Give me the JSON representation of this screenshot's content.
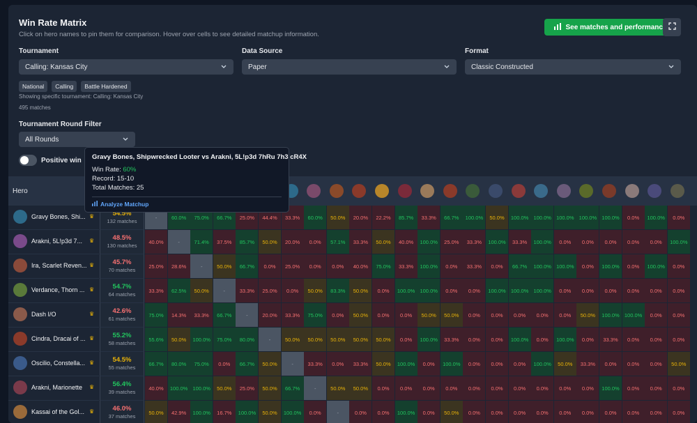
{
  "header": {
    "title": "Win Rate Matrix",
    "subtitle": "Click on hero names to pin them for comparison. Hover over cells to see detailed matchup information.",
    "matches_button": "See matches and performance"
  },
  "filters": {
    "tournament": {
      "label": "Tournament",
      "value": "Calling: Kansas City"
    },
    "data_source": {
      "label": "Data Source",
      "value": "Paper"
    },
    "format": {
      "label": "Format",
      "value": "Classic Constructed"
    },
    "tags": [
      "National",
      "Calling",
      "Battle Hardened"
    ],
    "showing_note": "Showing specific tournament: Calling: Kansas City",
    "match_count": "495 matches",
    "round": {
      "label": "Tournament Round Filter",
      "value": "All Rounds"
    },
    "toggle_label": "Positive win"
  },
  "tooltip": {
    "title": "Gravy Bones, Shipwrecked Looter vs Arakni, 5L!p3d 7hRu 7h3 cR4X",
    "win_rate_label": "Win Rate:",
    "win_rate_value": "60%",
    "record": "Record: 15-10",
    "total": "Total Matches: 25",
    "link": "Analyze Matchup"
  },
  "matrix": {
    "hero_header": "Hero",
    "colors": {
      "green": "#22c55e",
      "red": "#f87171",
      "yellow": "#eab308",
      "green_bg": "#14402e",
      "red_bg": "#3f1f2a",
      "yellow_bg": "#3b3420",
      "self_bg": "#4b5563"
    },
    "column_icon_colors": [
      "#2d6a8a",
      "#7a4a6a",
      "#8a4a2a",
      "#8a3a2a",
      "#b8862a",
      "#7a2a3a",
      "#9a7a5a",
      "#8a3a2a",
      "#3a5a3a",
      "#3a4a6a",
      "#8a3a3a",
      "#3a6a8a",
      "#6a5a7a",
      "#5a6a2a",
      "#7a3a2a",
      "#8a7a7a",
      "#4a4a7a",
      "#5a5a4a"
    ],
    "heroes": [
      {
        "name": "Gravy Bones, Shi...",
        "wr": "54.5%",
        "wr_color": "#eab308",
        "matches": "132 matches",
        "avatar": "#2d6a8a",
        "cells": [
          "-",
          "60.0%",
          "75.0%",
          "66.7%",
          "25.0%",
          "44.4%",
          "33.3%",
          "60.0%",
          "50.0%",
          "20.0%",
          "22.2%",
          "85.7%",
          "33.3%",
          "66.7%",
          "100.0%",
          "50.0%",
          "100.0%",
          "100.0%",
          "100.0%",
          "100.0%",
          "100.0%",
          "0.0%",
          "100.0%",
          "0.0%"
        ]
      },
      {
        "name": "Arakni, 5L!p3d 7...",
        "wr": "48.5%",
        "wr_color": "#f87171",
        "matches": "130 matches",
        "avatar": "#7a4a8a",
        "cells": [
          "40.0%",
          "-",
          "71.4%",
          "37.5%",
          "85.7%",
          "50.0%",
          "20.0%",
          "0.0%",
          "57.1%",
          "33.3%",
          "50.0%",
          "40.0%",
          "100.0%",
          "25.0%",
          "33.3%",
          "100.0%",
          "33.3%",
          "100.0%",
          "0.0%",
          "0.0%",
          "0.0%",
          "0.0%",
          "0.0%",
          "100.0%"
        ]
      },
      {
        "name": "Ira, Scarlet Reven...",
        "wr": "45.7%",
        "wr_color": "#f87171",
        "matches": "70 matches",
        "avatar": "#8a4a3a",
        "cells": [
          "25.0%",
          "28.6%",
          "-",
          "50.0%",
          "66.7%",
          "0.0%",
          "25.0%",
          "0.0%",
          "0.0%",
          "40.0%",
          "75.0%",
          "33.3%",
          "100.0%",
          "0.0%",
          "33.3%",
          "0.0%",
          "66.7%",
          "100.0%",
          "100.0%",
          "0.0%",
          "100.0%",
          "0.0%",
          "100.0%",
          "0.0%"
        ]
      },
      {
        "name": "Verdance, Thorn ...",
        "wr": "54.7%",
        "wr_color": "#22c55e",
        "matches": "64 matches",
        "avatar": "#5a7a3a",
        "cells": [
          "33.3%",
          "62.5%",
          "50.0%",
          "-",
          "33.3%",
          "25.0%",
          "0.0%",
          "50.0%",
          "83.3%",
          "50.0%",
          "0.0%",
          "100.0%",
          "100.0%",
          "0.0%",
          "0.0%",
          "100.0%",
          "100.0%",
          "100.0%",
          "0.0%",
          "0.0%",
          "0.0%",
          "0.0%",
          "0.0%",
          "0.0%"
        ]
      },
      {
        "name": "Dash I/O",
        "wr": "42.6%",
        "wr_color": "#f87171",
        "matches": "61 matches",
        "avatar": "#8a5a4a",
        "cells": [
          "75.0%",
          "14.3%",
          "33.3%",
          "66.7%",
          "-",
          "20.0%",
          "33.3%",
          "75.0%",
          "0.0%",
          "50.0%",
          "0.0%",
          "0.0%",
          "50.0%",
          "50.0%",
          "0.0%",
          "0.0%",
          "0.0%",
          "0.0%",
          "0.0%",
          "50.0%",
          "100.0%",
          "100.0%",
          "0.0%",
          "0.0%"
        ]
      },
      {
        "name": "Cindra, Dracai of ...",
        "wr": "55.2%",
        "wr_color": "#22c55e",
        "matches": "58 matches",
        "avatar": "#8a3a2a",
        "cells": [
          "55.6%",
          "50.0%",
          "100.0%",
          "75.0%",
          "80.0%",
          "-",
          "50.0%",
          "50.0%",
          "50.0%",
          "50.0%",
          "50.0%",
          "0.0%",
          "100.0%",
          "33.3%",
          "0.0%",
          "0.0%",
          "100.0%",
          "0.0%",
          "100.0%",
          "0.0%",
          "33.3%",
          "0.0%",
          "0.0%",
          "0.0%"
        ]
      },
      {
        "name": "Oscilio, Constella...",
        "wr": "54.5%",
        "wr_color": "#eab308",
        "matches": "55 matches",
        "avatar": "#3a5a8a",
        "cells": [
          "66.7%",
          "80.0%",
          "75.0%",
          "0.0%",
          "66.7%",
          "50.0%",
          "-",
          "33.3%",
          "0.0%",
          "33.3%",
          "50.0%",
          "100.0%",
          "0.0%",
          "100.0%",
          "0.0%",
          "0.0%",
          "0.0%",
          "100.0%",
          "50.0%",
          "33.3%",
          "0.0%",
          "0.0%",
          "0.0%",
          "50.0%"
        ]
      },
      {
        "name": "Arakni, Marionette",
        "wr": "56.4%",
        "wr_color": "#22c55e",
        "matches": "39 matches",
        "avatar": "#7a3a4a",
        "cells": [
          "40.0%",
          "100.0%",
          "100.0%",
          "50.0%",
          "25.0%",
          "50.0%",
          "66.7%",
          "-",
          "50.0%",
          "50.0%",
          "0.0%",
          "0.0%",
          "0.0%",
          "0.0%",
          "0.0%",
          "0.0%",
          "0.0%",
          "0.0%",
          "0.0%",
          "0.0%",
          "100.0%",
          "0.0%",
          "0.0%",
          "0.0%"
        ]
      },
      {
        "name": "Kassai of the Gol...",
        "wr": "46.0%",
        "wr_color": "#f87171",
        "matches": "37 matches",
        "avatar": "#9a6a3a",
        "cells": [
          "50.0%",
          "42.9%",
          "100.0%",
          "16.7%",
          "100.0%",
          "50.0%",
          "100.0%",
          "0.0%",
          "-",
          "0.0%",
          "0.0%",
          "100.0%",
          "0.0%",
          "50.0%",
          "0.0%",
          "0.0%",
          "0.0%",
          "0.0%",
          "0.0%",
          "0.0%",
          "0.0%",
          "0.0%",
          "0.0%",
          "0.0%"
        ]
      }
    ]
  }
}
